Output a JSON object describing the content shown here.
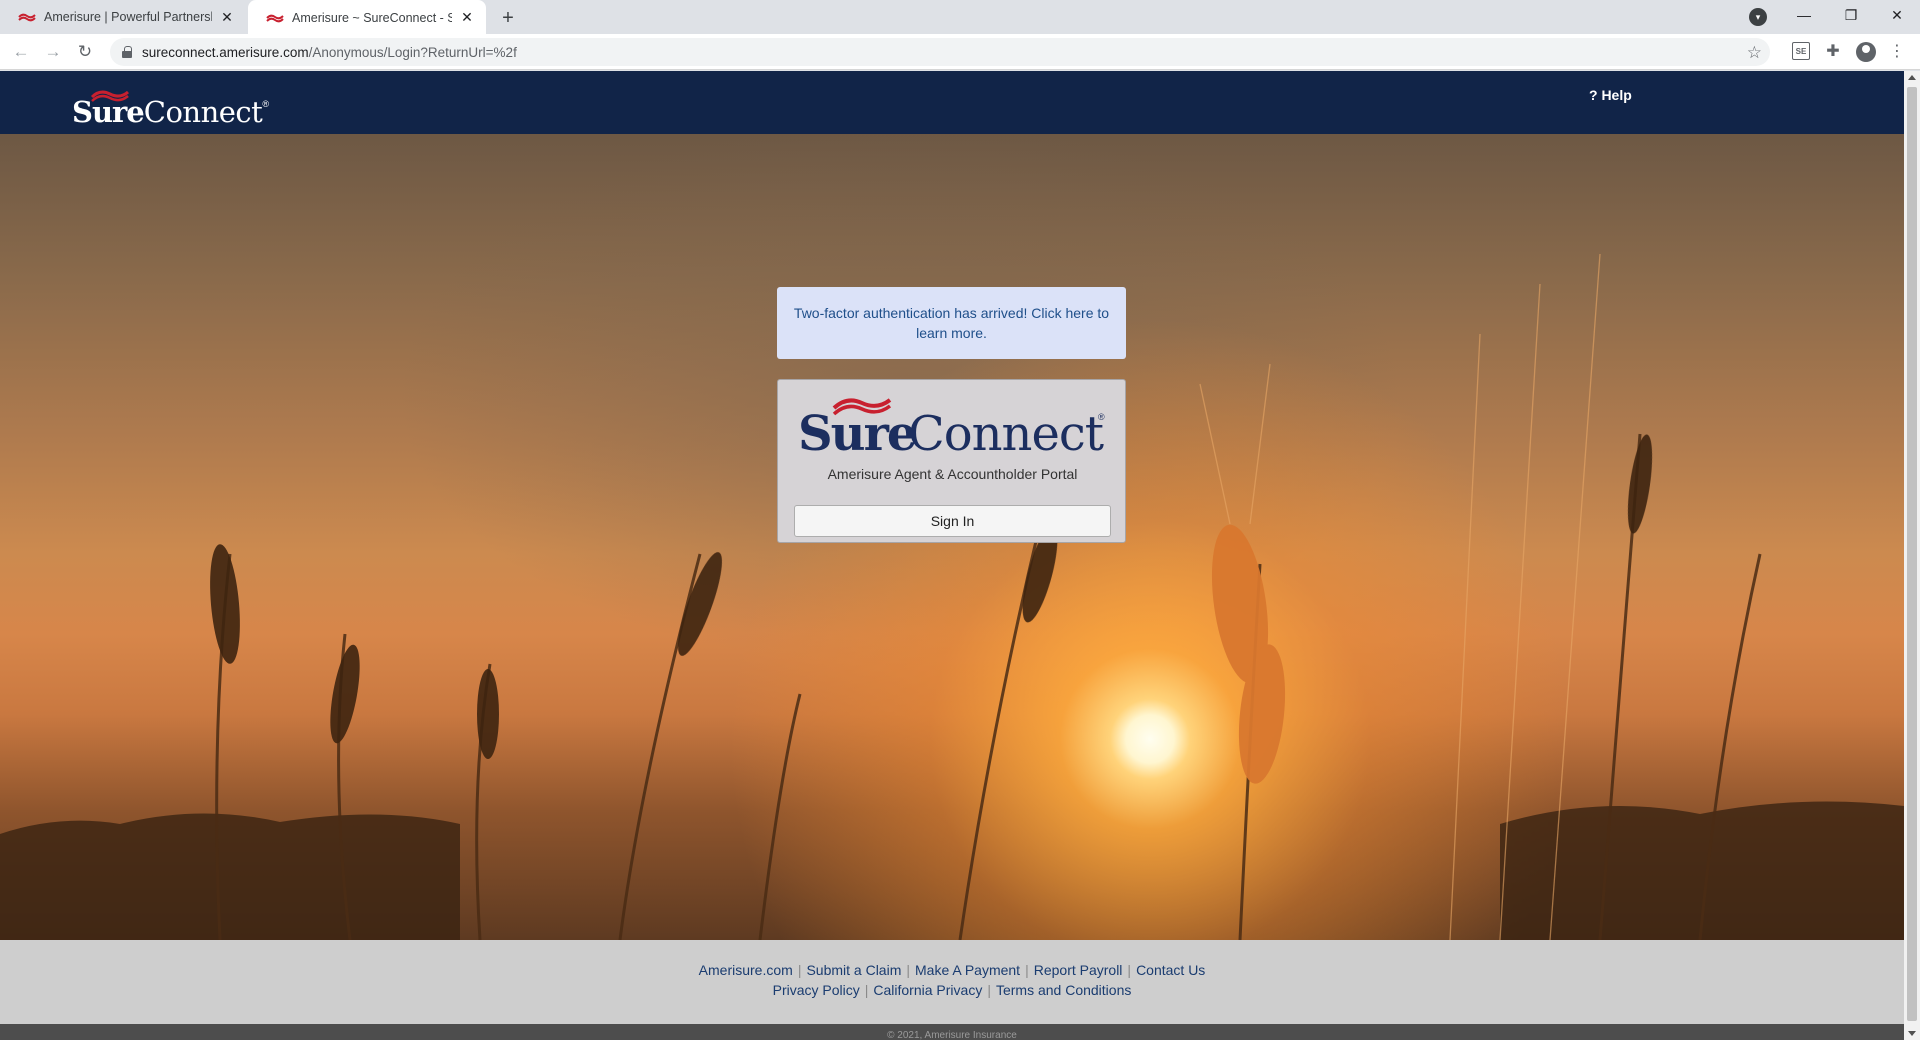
{
  "browser": {
    "tabs": [
      {
        "title": "Amerisure | Powerful Partnership",
        "active": false
      },
      {
        "title": "Amerisure ~ SureConnect - Sign",
        "active": true
      }
    ],
    "url_host": "sureconnect.amerisure.com",
    "url_path": "/Anonymous/Login?ReturnUrl=%2f",
    "ext_badge": "SE"
  },
  "header": {
    "logo_sure": "Sure",
    "logo_connect": "Connect",
    "logo_reg": "®",
    "help_label": "? Help",
    "background_color": "#112448"
  },
  "notice": {
    "text": "Two-factor authentication has arrived! Click here to learn more."
  },
  "login_card": {
    "logo_sure": "Sure",
    "logo_connect": "Connect",
    "logo_reg": "®",
    "subtitle": "Amerisure Agent & Accountholder Portal",
    "signin_label": "Sign In"
  },
  "footer": {
    "row1": [
      "Amerisure.com",
      "Submit a Claim",
      "Make A Payment",
      "Report Payroll",
      "Contact Us"
    ],
    "row2": [
      "Privacy Policy",
      "California Privacy",
      "Terms and Conditions"
    ],
    "copyright": "© 2021, Amerisure Insurance"
  },
  "colors": {
    "brand_navy": "#112448",
    "brand_red": "#c8202f",
    "link_blue": "#1a3c70"
  }
}
